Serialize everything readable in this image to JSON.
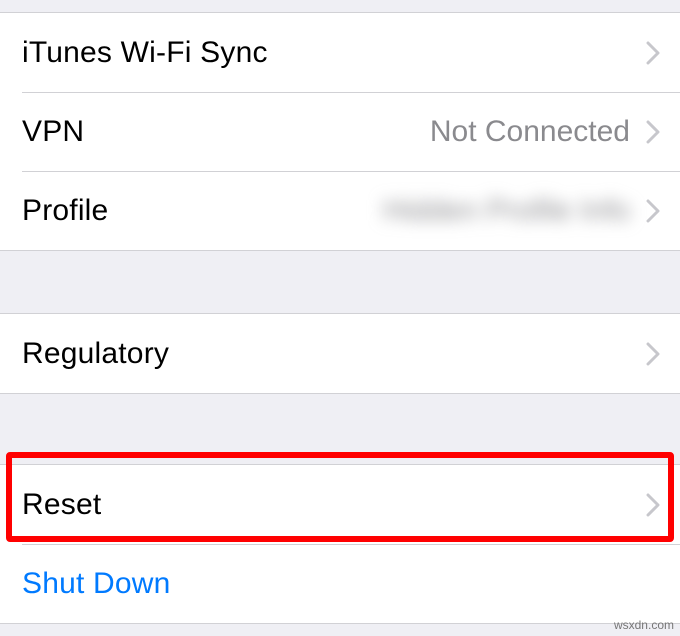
{
  "group1": {
    "itunes": {
      "label": "iTunes Wi-Fi Sync"
    },
    "vpn": {
      "label": "VPN",
      "detail": "Not Connected"
    },
    "profile": {
      "label": "Profile",
      "detail": "Hidden Profile Info"
    }
  },
  "group2": {
    "regulatory": {
      "label": "Regulatory"
    }
  },
  "group3": {
    "reset": {
      "label": "Reset"
    },
    "shutdown": {
      "label": "Shut Down"
    }
  },
  "watermark": "wsxdn.com"
}
